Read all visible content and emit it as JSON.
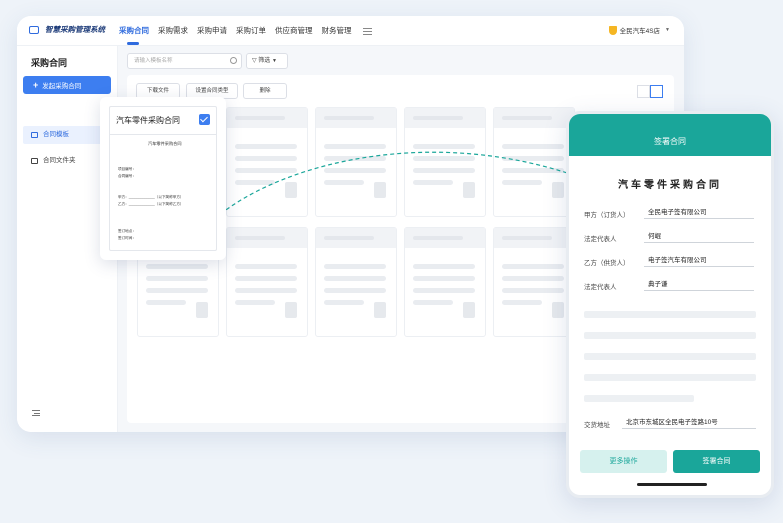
{
  "app": {
    "name": "智慧采购管理系统"
  },
  "nav": {
    "items": [
      "采购合同",
      "采购需求",
      "采购申请",
      "采购订单",
      "供应商管理",
      "财务管理"
    ],
    "active": "采购合同"
  },
  "company": {
    "name": "全民汽车4S店"
  },
  "sidebar": {
    "title": "采购合同",
    "new_button": "发起采购合同",
    "items": [
      {
        "label": "合同模板"
      },
      {
        "label": "合同文件夹"
      }
    ]
  },
  "search": {
    "placeholder": "请输入模板名称"
  },
  "filter": {
    "label": "筛选"
  },
  "toolbar": {
    "download": "下载文件",
    "set_type": "设置合同类型",
    "delete": "删除"
  },
  "template": {
    "title": "汽车零件采购合同",
    "doc_title": "汽车零件采购合同",
    "doc_lines": [
      "项目编号：",
      "合同编号：",
      "甲方：_____________（以下简称甲方）",
      "乙方：_____________（以下简称乙方）",
      "签订地点：",
      "签订时间："
    ]
  },
  "sign": {
    "header": "签署合同",
    "title": "汽车零件采购合同",
    "fields": [
      {
        "label": "甲方（订货人）",
        "value": "全民电子签有限公司"
      },
      {
        "label": "法定代表人",
        "value": "何崐"
      },
      {
        "label": "乙方（供货人）",
        "value": "电子签汽车有限公司"
      },
      {
        "label": "法定代表人",
        "value": "典子谦"
      }
    ],
    "address_label": "交货地址",
    "address_value": "北京市东城区全民电子签路10号",
    "more_button": "更多操作",
    "sign_button": "签署合同"
  },
  "colors": {
    "primary": "#3d7ef0",
    "teal": "#1aa69a"
  }
}
